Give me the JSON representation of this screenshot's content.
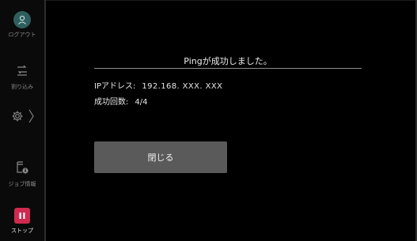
{
  "sidebar": {
    "logout_label": "ログアウト",
    "interrupt_label": "割り込み",
    "job_info_label": "ジョブ情報",
    "stop_label": "ストップ",
    "icons": [
      "user-icon",
      "interrupt-icon",
      "gear-icon",
      "chevron-right-icon",
      "job-info-icon",
      "pause-icon"
    ]
  },
  "dialog": {
    "title": "Pingが成功しました。",
    "ip_label": "IPアドレス:",
    "ip_value": "192.168. XXX. XXX",
    "success_count_label": "成功回数:",
    "success_count_value": "4/4",
    "close_button_label": "閉じる"
  },
  "colors": {
    "background": "#000000",
    "avatar": "#2f5e5e",
    "stop_button": "#cf2a4f",
    "close_button": "#5a5a5a",
    "text": "#e6e6e6"
  }
}
